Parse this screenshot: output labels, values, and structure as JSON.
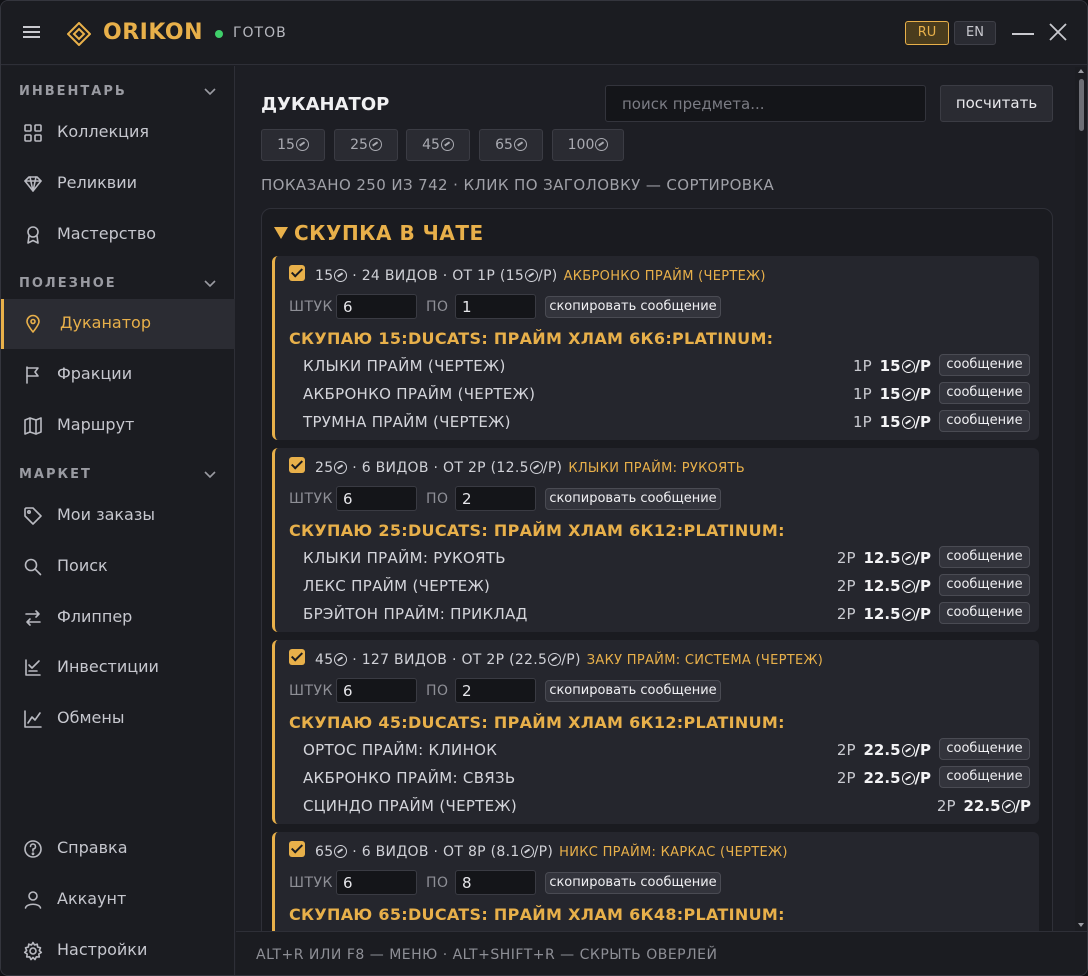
{
  "app": {
    "brand": "ORIKON",
    "status": "ГОТОВ",
    "status_color": "#3fcf6a",
    "accent": "#e8b04a"
  },
  "lang": {
    "ru": "RU",
    "en": "EN",
    "active": "RU"
  },
  "sidebar": {
    "sections": [
      {
        "title": "ИНВЕНТАРЬ",
        "items": [
          {
            "label": "Коллекция",
            "icon": "grid-icon"
          },
          {
            "label": "Реликвии",
            "icon": "diamond-icon"
          },
          {
            "label": "Мастерство",
            "icon": "medal-icon"
          }
        ]
      },
      {
        "title": "ПОЛЕЗНОЕ",
        "items": [
          {
            "label": "Дуканатор",
            "icon": "ducat-location-icon",
            "active": true
          },
          {
            "label": "Фракции",
            "icon": "flag-icon"
          },
          {
            "label": "Маршрут",
            "icon": "map-icon"
          }
        ]
      },
      {
        "title": "МАРКЕТ",
        "items": [
          {
            "label": "Мои заказы",
            "icon": "tag-icon"
          },
          {
            "label": "Поиск",
            "icon": "search-icon"
          },
          {
            "label": "Флиппер",
            "icon": "swap-icon"
          },
          {
            "label": "Инвестиции",
            "icon": "invest-icon"
          },
          {
            "label": "Обмены",
            "icon": "chart-icon"
          }
        ]
      }
    ],
    "bottom": [
      {
        "label": "Справка",
        "icon": "help-icon"
      },
      {
        "label": "Аккаунт",
        "icon": "user-icon"
      },
      {
        "label": "Настройки",
        "icon": "gear-icon"
      }
    ]
  },
  "main": {
    "title": "ДУКАНАТОР",
    "search_placeholder": "поиск предмета...",
    "calc_label": "посчитать",
    "filters": [
      "15",
      "25",
      "45",
      "65",
      "100"
    ],
    "summary": "ПОКАЗАНО 250 ИЗ 742 · КЛИК ПО ЗАГОЛОВКУ — СОРТИРОВКА",
    "panel_title": "СКУПКА В ЧАТЕ",
    "qty_label": "ШТУК",
    "price_label": "ПО",
    "copy_label": "скопировать сообщение",
    "msg_label": "сообщение",
    "cards": [
      {
        "ducats": "15",
        "info": "· 24 ВИДОВ · ОТ 1Р (15",
        "info_tail": "/Р)",
        "top": "АКБРОНКО ПРАЙМ (ЧЕРТЕЖ)",
        "qty": "6",
        "price": "1",
        "message": "СКУПАЮ 15:DUCATS: ПРАЙМ ХЛАМ 6К6:PLATINUM:",
        "rows": [
          {
            "name": "КЛЫКИ ПРАЙМ (ЧЕРТЕЖ)",
            "p": "1Р",
            "rate": "15",
            "has_btn": true
          },
          {
            "name": "АКБРОНКО ПРАЙМ (ЧЕРТЕЖ)",
            "p": "1Р",
            "rate": "15",
            "has_btn": true
          },
          {
            "name": "ТРУМНА ПРАЙМ (ЧЕРТЕЖ)",
            "p": "1Р",
            "rate": "15",
            "has_btn": true
          }
        ]
      },
      {
        "ducats": "25",
        "info": "· 6 ВИДОВ · ОТ 2Р (12.5",
        "info_tail": "/Р)",
        "top": "КЛЫКИ ПРАЙМ: РУКОЯТЬ",
        "qty": "6",
        "price": "2",
        "message": "СКУПАЮ 25:DUCATS: ПРАЙМ ХЛАМ 6К12:PLATINUM:",
        "rows": [
          {
            "name": "КЛЫКИ ПРАЙМ: РУКОЯТЬ",
            "p": "2Р",
            "rate": "12.5",
            "has_btn": true
          },
          {
            "name": "ЛЕКС ПРАЙМ (ЧЕРТЕЖ)",
            "p": "2Р",
            "rate": "12.5",
            "has_btn": true
          },
          {
            "name": "БРЭЙТОН ПРАЙМ: ПРИКЛАД",
            "p": "2Р",
            "rate": "12.5",
            "has_btn": true
          }
        ]
      },
      {
        "ducats": "45",
        "info": "· 127 ВИДОВ · ОТ 2Р (22.5",
        "info_tail": "/Р)",
        "top": "ЗАКУ ПРАЙМ: СИСТЕМА (ЧЕРТЕЖ)",
        "qty": "6",
        "price": "2",
        "message": "СКУПАЮ 45:DUCATS: ПРАЙМ ХЛАМ 6К12:PLATINUM:",
        "rows": [
          {
            "name": "ОРТОС ПРАЙМ: КЛИНОК",
            "p": "2Р",
            "rate": "22.5",
            "has_btn": true
          },
          {
            "name": "АКБРОНКО ПРАЙМ: СВЯЗЬ",
            "p": "2Р",
            "rate": "22.5",
            "has_btn": true
          },
          {
            "name": "СЦИНДО ПРАЙМ (ЧЕРТЕЖ)",
            "p": "2Р",
            "rate": "22.5",
            "has_btn": false
          }
        ]
      },
      {
        "ducats": "65",
        "info": "· 6 ВИДОВ · ОТ 8Р (8.1",
        "info_tail": "/Р)",
        "top": "НИКС ПРАЙМ: КАРКАС (ЧЕРТЕЖ)",
        "qty": "6",
        "price": "8",
        "message": "СКУПАЮ 65:DUCATS: ПРАЙМ ХЛАМ 6К48:PLATINUM:",
        "rows": []
      }
    ]
  },
  "footer": "ALT+R ИЛИ F8 — МЕНЮ · ALT+SHIFT+R — СКРЫТЬ ОВЕРЛЕЙ"
}
